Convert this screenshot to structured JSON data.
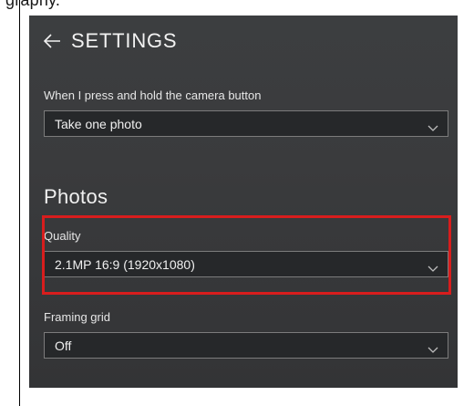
{
  "cropped_top_text": "graphy.",
  "header": {
    "title": "SETTINGS",
    "back_icon": "back-arrow-icon"
  },
  "camera_button": {
    "label": "When I press and hold the camera button",
    "value": "Take one photo"
  },
  "photos": {
    "section_title": "Photos",
    "quality": {
      "label": "Quality",
      "value": "2.1MP 16:9 (1920x1080)"
    },
    "framing_grid": {
      "label": "Framing grid",
      "value": "Off"
    }
  },
  "colors": {
    "panel_background": "#3a3b3d",
    "highlight": "#d81d1d",
    "dropdown_background": "#26282a",
    "dropdown_border": "#7c7c7c"
  }
}
